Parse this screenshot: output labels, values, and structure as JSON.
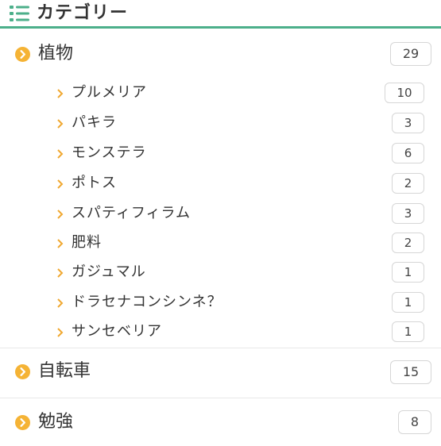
{
  "header": {
    "title": "カテゴリー",
    "icon": "list-icon",
    "accent_color": "#4caf8a"
  },
  "categories": [
    {
      "label": "植物",
      "count": "29",
      "icon": "circle-chevron-icon",
      "children": [
        {
          "label": "プルメリア",
          "count": "10"
        },
        {
          "label": "パキラ",
          "count": "3"
        },
        {
          "label": "モンステラ",
          "count": "6"
        },
        {
          "label": "ポトス",
          "count": "2"
        },
        {
          "label": "スパティフィラム",
          "count": "3"
        },
        {
          "label": "肥料",
          "count": "2"
        },
        {
          "label": "ガジュマル",
          "count": "1"
        },
        {
          "label": "ドラセナコンシンネ？",
          "count": "1"
        },
        {
          "label": "サンセベリア",
          "count": "1"
        }
      ]
    },
    {
      "label": "自転車",
      "count": "15",
      "icon": "circle-chevron-icon"
    },
    {
      "label": "勉強",
      "count": "8",
      "icon": "circle-chevron-icon"
    }
  ],
  "colors": {
    "icon_orange": "#f5b335",
    "chevron_orange": "#f0a830",
    "badge_border": "#d6d6d6",
    "divider": "#e8e8e8"
  }
}
